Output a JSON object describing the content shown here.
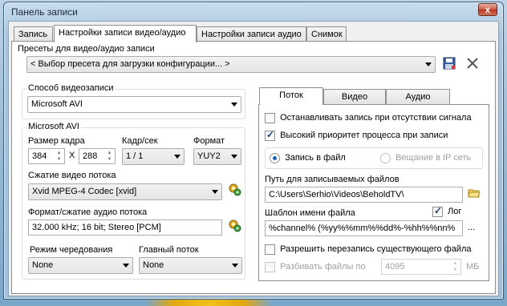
{
  "window": {
    "title": "Панель записи",
    "close_glyph": "x"
  },
  "tabs": [
    "Запись",
    "Настройки записи видео/аудио",
    "Настройки записи аудио",
    "Снимок"
  ],
  "active_tab": 1,
  "presets": {
    "label": "Пресеты для видео/аудио записи",
    "value": "< Выбор пресета для загрузки конфигурации... >",
    "save_icon": "save-icon",
    "delete_icon": "close-icon"
  },
  "video_method": {
    "label": "Способ видеозаписи",
    "value": "Microsoft AVI"
  },
  "msavi": {
    "group_label": "Microsoft AVI",
    "frame_size_label": "Размер кадра",
    "width": "384",
    "x_sep": "X",
    "height": "288",
    "fps_label": "Кадр/сек",
    "fps_value": "1 / 1",
    "format_label": "Формат",
    "format_value": "YUY2",
    "compression_label": "Сжатие видео потока",
    "compression_value": "Xvid MPEG-4 Codec [xvid]",
    "audio_label": "Формат/сжатие аудио потока",
    "audio_value": "32.000 kHz; 16 bit; Stereo [PCM]",
    "interleave_label": "Режим чередования",
    "interleave_value": "None",
    "master_label": "Главный поток",
    "master_value": "None",
    "settings_icon": "settings-gear-icon"
  },
  "right_tabs": [
    "Поток",
    "Видео",
    "Аудио"
  ],
  "right_active_tab": 0,
  "stream": {
    "stop_no_signal": "Останавливать запись при отсутствии сигнала",
    "stop_no_signal_checked": false,
    "high_priority": "Высокий приоритет процесса при записи",
    "high_priority_checked": true,
    "record_to_file": "Запись в файл",
    "broadcast_ip": "Вещание в IP сеть",
    "record_mode": "file",
    "path_label": "Путь для записываемых файлов",
    "path_value": "C:\\Users\\Serhio\\Videos\\BeholdTV\\",
    "folder_icon": "folder-icon",
    "template_label": "Шаблон имени файла",
    "log_label": "Лог",
    "log_checked": true,
    "template_value": "%channel% (%yy%%mm%%dd%-%hh%%nn%",
    "template_more": "...",
    "allow_overwrite": "Разрешить перезапись существующего файла",
    "allow_overwrite_checked": false,
    "split_files": "Разбивать файлы по",
    "split_files_checked": false,
    "split_value": "4095",
    "split_unit": "МБ"
  }
}
